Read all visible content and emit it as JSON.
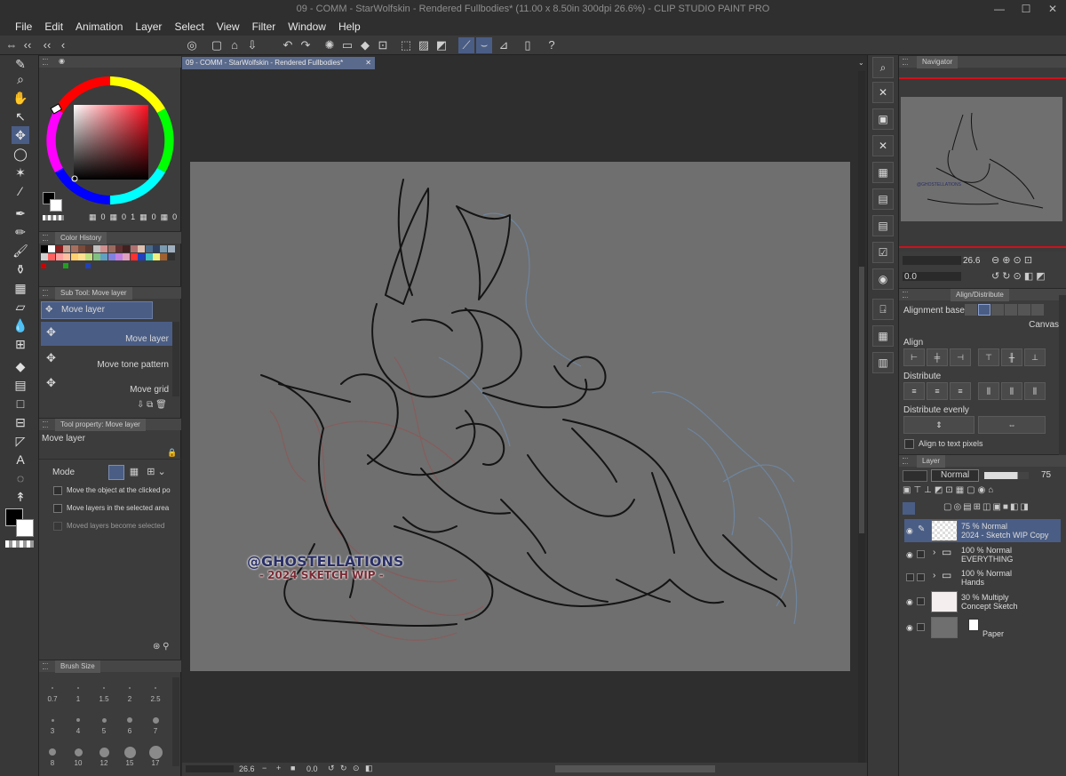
{
  "window": {
    "title": "09 - COMM - StarWolfskin - Rendered Fullbodies* (11.00 x 8.50in 300dpi 26.6%)  - CLIP STUDIO PAINT PRO"
  },
  "menu": [
    "File",
    "Edit",
    "Animation",
    "Layer",
    "Select",
    "View",
    "Filter",
    "Window",
    "Help"
  ],
  "document": {
    "tab_label": "09 - COMM - StarWolfskin - Rendered Fullbodies*"
  },
  "color_panel": {
    "values": [
      "0",
      "0",
      "1",
      "0",
      "0"
    ]
  },
  "color_history": {
    "title": "Color History"
  },
  "subtool": {
    "title": "Sub Tool: Move layer",
    "group_label": "Move layer",
    "items": [
      "Move layer",
      "Move tone pattern",
      "Move grid"
    ]
  },
  "tool_property": {
    "title": "Tool property: Move layer",
    "name": "Move layer",
    "mode_label": "Mode",
    "options": [
      "Move the object at the clicked position",
      "Move layers in the selected area",
      "Moved layers become selected"
    ]
  },
  "brush_size": {
    "title": "Brush Size",
    "sizes": [
      "0.7",
      "1",
      "1.5",
      "2",
      "2.5",
      "3",
      "4",
      "5",
      "6",
      "7",
      "8",
      "10",
      "12",
      "15",
      "17"
    ]
  },
  "navigator": {
    "title": "Navigator",
    "zoom": "26.6",
    "angle": "0.0"
  },
  "align": {
    "title": "Align/Distribute",
    "base_label": "Alignment base",
    "base_value": "Canvas",
    "align_label": "Align",
    "distribute_label": "Distribute",
    "distribute_evenly_label": "Distribute evenly",
    "align_to_text": "Align to text pixels"
  },
  "layer_panel": {
    "title": "Layer",
    "blend_mode": "Normal",
    "opacity": "75",
    "layers": [
      {
        "mode": "75 % Normal",
        "name": "2024 - Sketch WIP Copy"
      },
      {
        "mode": "100 % Normal",
        "name": "EVERYTHING"
      },
      {
        "mode": "100 % Normal",
        "name": "Hands"
      },
      {
        "mode": "30 % Multiply",
        "name": "Concept Sketch"
      },
      {
        "mode": "",
        "name": "Paper"
      }
    ]
  },
  "watermark": {
    "line1": "@GHOSTELLATIONS",
    "line2": "- 2024 SKETCH WIP -"
  },
  "status": {
    "zoom": "26.6",
    "angle": "0.0"
  },
  "colors": {
    "accent": "#4a5d85",
    "canvas_bg": "#6f6f6f",
    "sketch_line": "#141414",
    "sketch_red": "#8a5a5a",
    "sketch_blue": "#6e89a8"
  }
}
